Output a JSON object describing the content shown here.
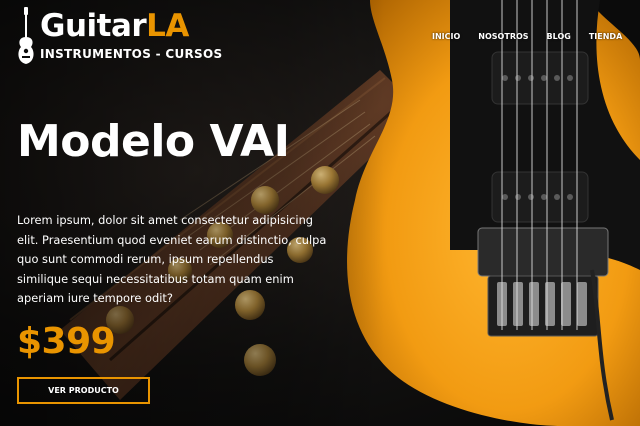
{
  "header": {
    "logo": {
      "brand_word": "Guitar",
      "brand_accent": "LA",
      "tagline": "INSTRUMENTOS - CURSOS",
      "icon": "guitar-icon"
    },
    "nav": [
      {
        "label": "INICIO"
      },
      {
        "label": "NOSOTROS"
      },
      {
        "label": "BLOG"
      },
      {
        "label": "TIENDA"
      }
    ]
  },
  "hero": {
    "title": "Modelo VAI",
    "description": "Lorem ipsum, dolor sit amet consectetur adipisicing elit. Praesentium quod eveniet earum distinctio, culpa quo sunt commodi rerum, ipsum repellendus similique sequi necessitatibus totam quam enim aperiam iure tempore odit?",
    "price": "$399",
    "cta_label": "VER PRODUCTO"
  },
  "colors": {
    "accent": "#e99400",
    "text": "#ffffff",
    "background": "#0b0b0b",
    "guitar_body": "#f2a21a"
  }
}
